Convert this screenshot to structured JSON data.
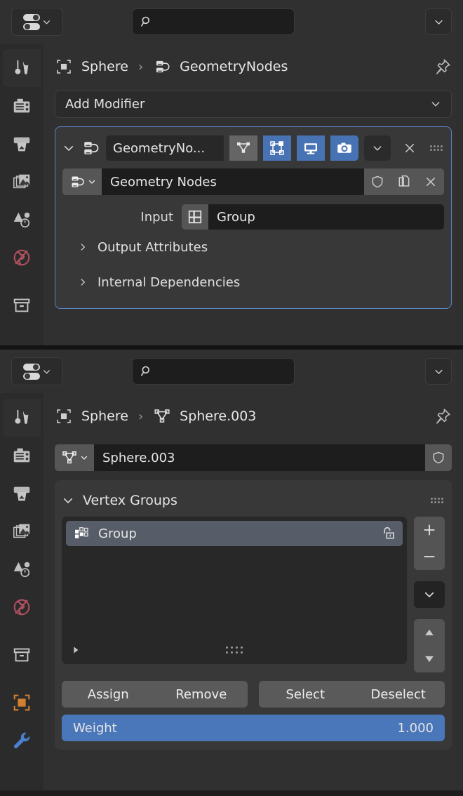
{
  "theme": {
    "accent_blue": "#4772b3",
    "slider_blue": "#4a76ba",
    "panel_bg": "#383838",
    "editor_bg": "#303030",
    "field_bg": "#1d1d1d",
    "outline_active": "#5b84c4",
    "world_icon_color": "#b05060",
    "object_icon_color": "#d08030"
  },
  "modifier_editor": {
    "header": {
      "editor_type_icon": "properties-editor-icon",
      "search_placeholder": "",
      "search_icon": "search-icon",
      "options_icon": "chevron-down-icon"
    },
    "tabs": [
      {
        "name": "tool",
        "icon": "tool-icon",
        "selected": true
      },
      {
        "name": "render",
        "icon": "render-camera-icon",
        "selected": false
      },
      {
        "name": "output",
        "icon": "output-printer-icon",
        "selected": false
      },
      {
        "name": "view-layer",
        "icon": "view-layer-images-icon",
        "selected": false
      },
      {
        "name": "scene",
        "icon": "scene-cone-sphere-icon",
        "selected": false
      },
      {
        "name": "world",
        "icon": "world-globe-icon",
        "selected": false
      },
      {
        "name": "collection",
        "icon": "collection-box-icon",
        "selected": false
      }
    ],
    "breadcrumb": {
      "object_icon": "object-data-icon",
      "object": "Sphere",
      "separator": "›",
      "node_icon": "geometry-nodes-icon",
      "datablock": "GeometryNodes",
      "pin_icon": "pin-icon"
    },
    "add_modifier": {
      "label": "Add Modifier",
      "chevron": "chevron-down-icon"
    },
    "modifier": {
      "expand_icon": "chevron-down-icon",
      "type_icon": "geometry-nodes-icon",
      "name": "GeometryNo...",
      "toggles": [
        {
          "name": "edit-mode",
          "icon": "vertex-triangle-icon",
          "on": false
        },
        {
          "name": "realtime-edit-mode",
          "icon": "editmode-points-icon",
          "on": true
        },
        {
          "name": "display-viewport",
          "icon": "monitor-icon",
          "on": true
        },
        {
          "name": "render",
          "icon": "camera-icon",
          "on": true
        }
      ],
      "extras_icon": "chevron-down-icon",
      "close_icon": "x-icon",
      "grip_icon": "drag-dots-icon",
      "node_group": {
        "browse_icon": "geometry-nodes-icon",
        "browse_chevron": "chevron-down-icon",
        "name": "Geometry Nodes",
        "fake_user_icon": "shield-icon",
        "duplicate_icon": "copy-icon",
        "unlink_icon": "x-icon"
      },
      "input_row": {
        "label": "Input",
        "icon": "vertex-group-grid-icon",
        "value": "Group"
      },
      "sections": [
        {
          "label": "Output Attributes",
          "icon": "chevron-right-icon",
          "expanded": false
        },
        {
          "label": "Internal Dependencies",
          "icon": "chevron-right-icon",
          "expanded": false
        }
      ]
    }
  },
  "data_editor": {
    "header": {
      "editor_type_icon": "properties-editor-icon",
      "search_placeholder": "",
      "search_icon": "search-icon",
      "options_icon": "chevron-down-icon"
    },
    "tabs": [
      {
        "name": "tool",
        "icon": "tool-icon",
        "selected": true
      },
      {
        "name": "render",
        "icon": "render-camera-icon",
        "selected": false
      },
      {
        "name": "output",
        "icon": "output-printer-icon",
        "selected": false
      },
      {
        "name": "view-layer",
        "icon": "view-layer-images-icon",
        "selected": false
      },
      {
        "name": "scene",
        "icon": "scene-cone-sphere-icon",
        "selected": false
      },
      {
        "name": "world",
        "icon": "world-globe-icon",
        "selected": false
      },
      {
        "name": "collection",
        "icon": "collection-box-icon",
        "selected": false
      },
      {
        "name": "object",
        "icon": "object-square-icon",
        "selected": false
      },
      {
        "name": "modifiers",
        "icon": "wrench-icon",
        "selected": false
      }
    ],
    "breadcrumb": {
      "object_icon": "object-data-icon",
      "object": "Sphere",
      "separator": "›",
      "mesh_icon": "mesh-data-icon",
      "datablock": "Sphere.003",
      "pin_icon": "pin-icon"
    },
    "id_row": {
      "browse_icon": "mesh-data-icon",
      "browse_chevron": "chevron-down-icon",
      "name": "Sphere.003",
      "fake_user_icon": "shield-icon"
    },
    "vertex_groups": {
      "title": "Vertex Groups",
      "expand_icon": "chevron-down-icon",
      "grip_icon": "drag-dots-icon",
      "items": [
        {
          "name": "Group",
          "icon": "vertex-group-icon",
          "lock_icon": "unlock-icon",
          "selected": true
        }
      ],
      "list_expand_icon": "triangle-right-icon",
      "list_grip_icon": "drag-dots-icon",
      "side_buttons": [
        {
          "name": "add-vertex-group",
          "icon": "plus-icon"
        },
        {
          "name": "remove-vertex-group",
          "icon": "minus-icon"
        },
        {
          "name": "vertex-group-specials",
          "icon": "chevron-down-icon"
        },
        {
          "name": "move-group-up",
          "icon": "triangle-up-icon"
        },
        {
          "name": "move-group-down",
          "icon": "triangle-down-icon"
        }
      ],
      "actions": [
        {
          "name": "assign",
          "label": "Assign"
        },
        {
          "name": "remove",
          "label": "Remove"
        },
        {
          "name": "select",
          "label": "Select"
        },
        {
          "name": "deselect",
          "label": "Deselect"
        }
      ],
      "weight": {
        "label": "Weight",
        "value": "1.000"
      }
    }
  }
}
